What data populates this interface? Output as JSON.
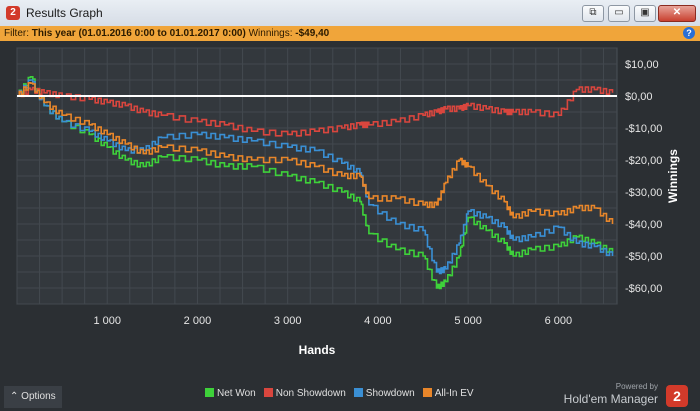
{
  "window": {
    "title": "Results Graph",
    "app_icon_glyph": "2",
    "buttons": {
      "pin": "⧉",
      "restore": "▭",
      "maximize": "▣",
      "close": "✕"
    }
  },
  "filter": {
    "prefix": "Filter:",
    "period": "This year (01.01.2016 0:00 to 01.01.2017 0:00)",
    "winnings_label": "Winnings:",
    "winnings_value": "-$49,40"
  },
  "chart_data": {
    "type": "line",
    "xlabel": "Hands",
    "ylabel": "Winnings",
    "xlim": [
      0,
      6650
    ],
    "ylim": [
      -65,
      15
    ],
    "x_ticks": [
      1000,
      2000,
      3000,
      4000,
      5000,
      6000
    ],
    "x_tick_labels": [
      "1 000",
      "2 000",
      "3 000",
      "4 000",
      "5 000",
      "6 000"
    ],
    "y_ticks": [
      10,
      0,
      -10,
      -20,
      -30,
      -40,
      -50,
      -60
    ],
    "y_tick_labels": [
      "$10,00",
      "$0,00",
      "-$10,00",
      "-$20,00",
      "-$30,00",
      "-$40,00",
      "-$50,00",
      "-$60,00"
    ],
    "zero_line": true,
    "grid": true,
    "legend_position": "bottom",
    "x": [
      0,
      150,
      300,
      500,
      800,
      1000,
      1200,
      1400,
      1600,
      2000,
      2300,
      2600,
      3000,
      3300,
      3600,
      3800,
      3900,
      4200,
      4500,
      4650,
      4750,
      4900,
      5000,
      5200,
      5400,
      5500,
      5700,
      6000,
      6200,
      6400,
      6600
    ],
    "series": [
      {
        "name": "Net Won",
        "color": "#3ed13a",
        "values": [
          0,
          6,
          -3,
          -8,
          -12,
          -16,
          -20,
          -22,
          -19,
          -20,
          -22,
          -22,
          -25,
          -27,
          -30,
          -33,
          -43,
          -48,
          -50,
          -60,
          -58,
          -50,
          -38,
          -42,
          -46,
          -50,
          -48,
          -47,
          -44,
          -46,
          -49
        ]
      },
      {
        "name": "Non Showdown",
        "color": "#d9463e",
        "values": [
          0,
          2,
          1,
          0,
          -1,
          -2,
          -3,
          -5,
          -6,
          -8,
          -9,
          -11,
          -12,
          -11,
          -10,
          -9,
          -9,
          -8,
          -6,
          -5,
          -4,
          -4,
          -3,
          -4,
          -5,
          -5,
          -5,
          -6,
          2,
          2,
          1
        ]
      },
      {
        "name": "Showdown",
        "color": "#3a8fd4",
        "values": [
          0,
          5,
          -3,
          -8,
          -11,
          -14,
          -17,
          -17,
          -13,
          -12,
          -13,
          -14,
          -16,
          -17,
          -21,
          -24,
          -34,
          -40,
          -42,
          -55,
          -54,
          -46,
          -36,
          -38,
          -41,
          -45,
          -44,
          -41,
          -46,
          -47,
          -50
        ]
      },
      {
        "name": "All-In EV",
        "color": "#e8862a",
        "values": [
          0,
          4,
          -2,
          -6,
          -9,
          -12,
          -15,
          -18,
          -16,
          -17,
          -19,
          -20,
          -20,
          -22,
          -25,
          -25,
          -32,
          -32,
          -34,
          -34,
          -27,
          -20,
          -22,
          -28,
          -33,
          -38,
          -36,
          -37,
          -35,
          -35,
          -40
        ]
      }
    ]
  },
  "bottom": {
    "options_label": "Options",
    "options_icon": "chevron-up-icon",
    "powered_by": "Powered by",
    "brand_name": "Hold'em Manager",
    "brand_logo_glyph": "2"
  }
}
